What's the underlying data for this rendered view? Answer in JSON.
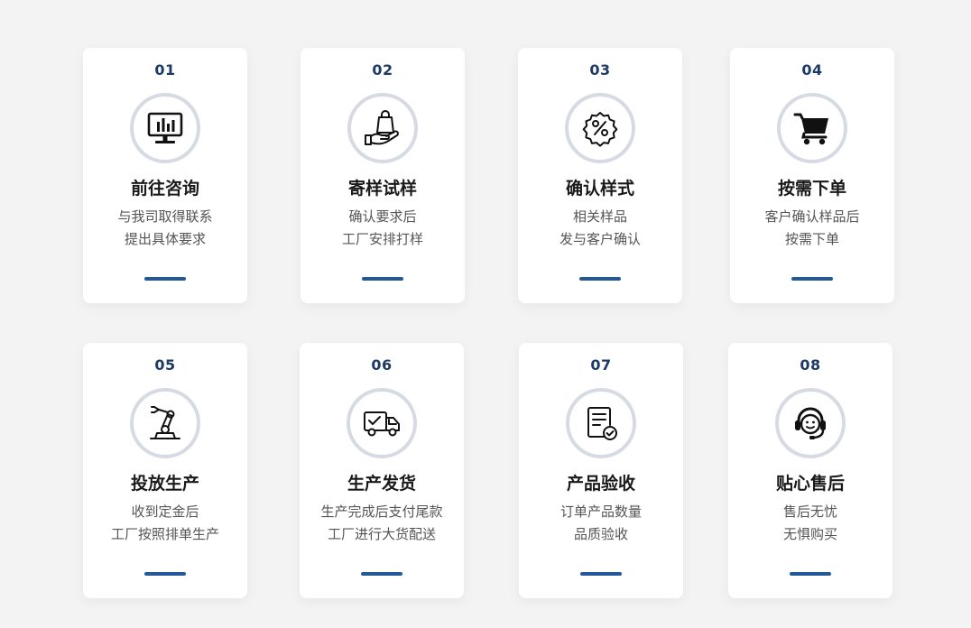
{
  "steps": [
    {
      "num": "01",
      "title": "前往咨询",
      "line1": "与我司取得联系",
      "line2": "提出具体要求",
      "icon": "monitor-chart-icon"
    },
    {
      "num": "02",
      "title": "寄样试样",
      "line1": "确认要求后",
      "line2": "工厂安排打样",
      "icon": "shopping-bag-hand-icon"
    },
    {
      "num": "03",
      "title": "确认样式",
      "line1": "相关样品",
      "line2": "发与客户确认",
      "icon": "percent-badge-icon"
    },
    {
      "num": "04",
      "title": "按需下单",
      "line1": "客户确认样品后",
      "line2": "按需下单",
      "icon": "shopping-cart-icon"
    },
    {
      "num": "05",
      "title": "投放生产",
      "line1": "收到定金后",
      "line2": "工厂按照排单生产",
      "icon": "robot-arm-icon"
    },
    {
      "num": "06",
      "title": "生产发货",
      "line1": "生产完成后支付尾款",
      "line2": "工厂进行大货配送",
      "icon": "delivery-truck-icon"
    },
    {
      "num": "07",
      "title": "产品验收",
      "line1": "订单产品数量",
      "line2": "品质验收",
      "icon": "document-check-icon"
    },
    {
      "num": "08",
      "title": "贴心售后",
      "line1": "售后无忧",
      "line2": "无惧购买",
      "icon": "headset-support-icon"
    }
  ],
  "colors": {
    "number": "#1d3a66",
    "accent_bar": "#24589c",
    "ring": "#d6dbe3",
    "background": "#f3f3f4"
  }
}
